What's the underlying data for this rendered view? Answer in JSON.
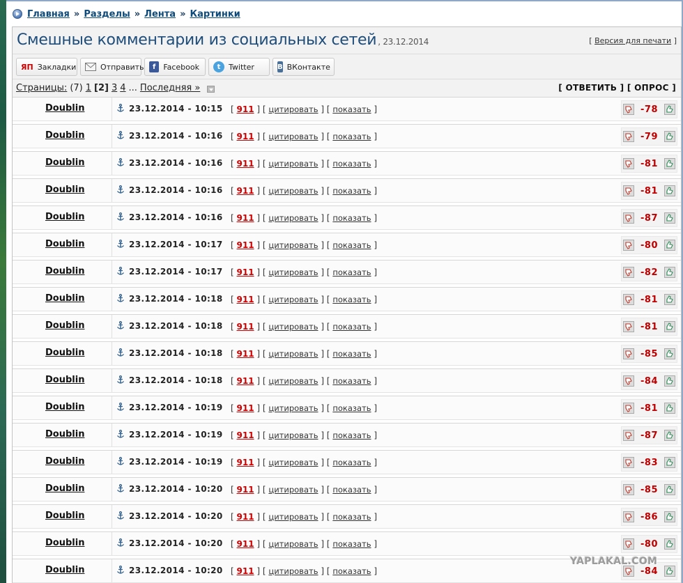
{
  "breadcrumb": [
    {
      "label": "Главная"
    },
    {
      "label": "Разделы"
    },
    {
      "label": "Лента"
    },
    {
      "label": "Картинки"
    }
  ],
  "breadcrumb_sep": "»",
  "topic": {
    "title": "Смешные комментарии из социальных сетей",
    "date": ", 23.12.2014",
    "print_label": "Версия для печати"
  },
  "share": [
    {
      "label": "Закладки",
      "icon": "yandex-bookmarks-icon",
      "icon_text": "ЯП",
      "color": "#ffffff"
    },
    {
      "label": "Отправить",
      "icon": "envelope-icon",
      "icon_text": "",
      "color": "#ffffff"
    },
    {
      "label": "Facebook",
      "icon": "facebook-icon",
      "icon_text": "f",
      "color": "#3b5998"
    },
    {
      "label": "Twitter",
      "icon": "twitter-icon",
      "icon_text": "t",
      "color": "#4aa3df"
    },
    {
      "label": "ВКонтакте",
      "icon": "vkontakte-icon",
      "icon_text": "B",
      "color": "#4a6f97"
    }
  ],
  "pagination": {
    "label": "Страницы:",
    "count": "(7)",
    "pages": [
      "1",
      "[2]",
      "3",
      "4"
    ],
    "ellipsis": "...",
    "last": "Последняя »"
  },
  "actions": {
    "reply": "[ ОТВЕТИТЬ ]",
    "poll": "[ ОПРОС ]"
  },
  "comment_links": {
    "num": "911",
    "quote": "цитировать",
    "show": "показать"
  },
  "comments": [
    {
      "author": "Doublin",
      "date": "23.12.2014 - 10:15",
      "rating": "-78"
    },
    {
      "author": "Doublin",
      "date": "23.12.2014 - 10:16",
      "rating": "-79"
    },
    {
      "author": "Doublin",
      "date": "23.12.2014 - 10:16",
      "rating": "-81"
    },
    {
      "author": "Doublin",
      "date": "23.12.2014 - 10:16",
      "rating": "-81"
    },
    {
      "author": "Doublin",
      "date": "23.12.2014 - 10:16",
      "rating": "-87"
    },
    {
      "author": "Doublin",
      "date": "23.12.2014 - 10:17",
      "rating": "-80"
    },
    {
      "author": "Doublin",
      "date": "23.12.2014 - 10:17",
      "rating": "-82"
    },
    {
      "author": "Doublin",
      "date": "23.12.2014 - 10:18",
      "rating": "-81"
    },
    {
      "author": "Doublin",
      "date": "23.12.2014 - 10:18",
      "rating": "-81"
    },
    {
      "author": "Doublin",
      "date": "23.12.2014 - 10:18",
      "rating": "-85"
    },
    {
      "author": "Doublin",
      "date": "23.12.2014 - 10:18",
      "rating": "-84"
    },
    {
      "author": "Doublin",
      "date": "23.12.2014 - 10:19",
      "rating": "-81"
    },
    {
      "author": "Doublin",
      "date": "23.12.2014 - 10:19",
      "rating": "-87"
    },
    {
      "author": "Doublin",
      "date": "23.12.2014 - 10:19",
      "rating": "-83"
    },
    {
      "author": "Doublin",
      "date": "23.12.2014 - 10:20",
      "rating": "-85"
    },
    {
      "author": "Doublin",
      "date": "23.12.2014 - 10:20",
      "rating": "-86"
    },
    {
      "author": "Doublin",
      "date": "23.12.2014 - 10:20",
      "rating": "-80"
    },
    {
      "author": "Doublin",
      "date": "23.12.2014 - 10:20",
      "rating": "-84"
    }
  ],
  "watermark": "YAPLAKAL.COM",
  "colors": {
    "title": "#1f4d7a",
    "rating": "#c00000",
    "num_link": "#cc0000"
  }
}
